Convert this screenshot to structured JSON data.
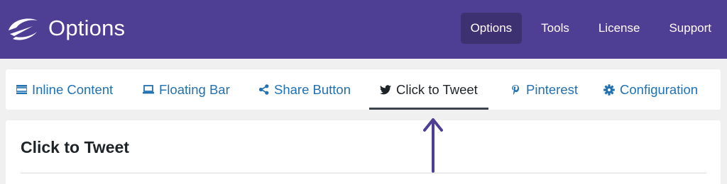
{
  "header": {
    "title": "Options",
    "logo_icon": "brand-logo-icon",
    "nav": [
      {
        "label": "Options",
        "active": true
      },
      {
        "label": "Tools",
        "active": false
      },
      {
        "label": "License",
        "active": false
      },
      {
        "label": "Support",
        "active": false
      }
    ]
  },
  "tabs": [
    {
      "label": "Inline Content",
      "icon": "inline-content-icon",
      "active": false
    },
    {
      "label": "Floating Bar",
      "icon": "laptop-icon",
      "active": false
    },
    {
      "label": "Share Button",
      "icon": "share-icon",
      "active": false
    },
    {
      "label": "Click to Tweet",
      "icon": "twitter-bird-icon",
      "active": true
    },
    {
      "label": "Pinterest",
      "icon": "pinterest-icon",
      "active": false
    },
    {
      "label": "Configuration",
      "icon": "gear-icon",
      "active": false
    }
  ],
  "panel": {
    "title": "Click to Tweet"
  },
  "colors": {
    "header_bg": "#4f3f94",
    "active_nav_bg": "#3e3172",
    "tab_link": "#2271b1",
    "annotation_arrow": "#4f3f94"
  }
}
